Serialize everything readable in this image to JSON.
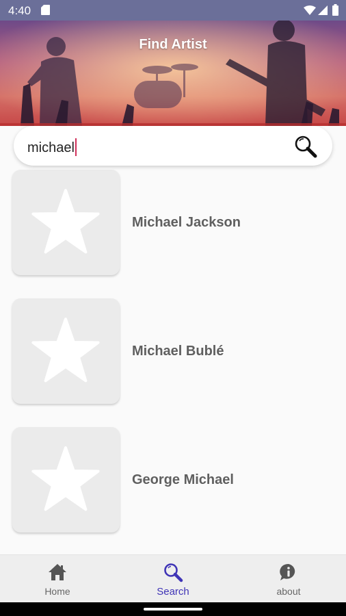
{
  "status_bar": {
    "time": "4:40",
    "icons": [
      "sd-card-icon",
      "wifi-icon",
      "signal-icon",
      "battery-icon"
    ]
  },
  "header": {
    "title": "Find Artist"
  },
  "search": {
    "value": "michael",
    "icon": "search-icon"
  },
  "results": [
    {
      "name": "Michael Jackson",
      "icon": "star-icon"
    },
    {
      "name": "Michael Bublé",
      "icon": "star-icon"
    },
    {
      "name": "George Michael",
      "icon": "star-icon"
    }
  ],
  "bottom_nav": {
    "active": "Search",
    "items": [
      {
        "label": "Home",
        "icon": "home-icon"
      },
      {
        "label": "Search",
        "icon": "search-icon"
      },
      {
        "label": "about",
        "icon": "info-chat-icon"
      }
    ]
  },
  "colors": {
    "status_bar": "#6b6f99",
    "active_tab": "#3f34b6",
    "caret": "#d0305a"
  }
}
